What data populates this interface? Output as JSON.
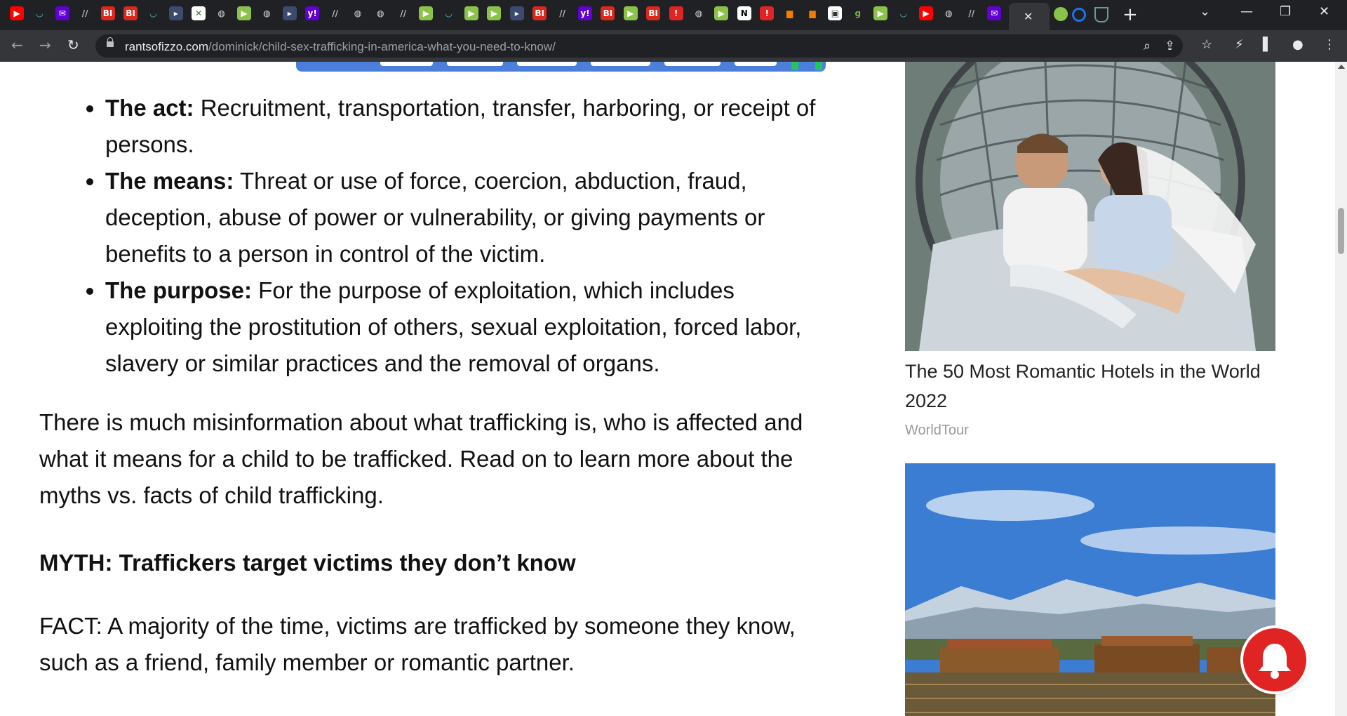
{
  "browser": {
    "tabs_icons": [
      "youtube-icon",
      "shield-icon",
      "yahoo-mail-icon",
      "site-icon",
      "bi-icon",
      "bi-icon",
      "shield-icon",
      "arrow-icon",
      "sheet-icon",
      "globe-icon",
      "play-icon",
      "globe-icon",
      "arrow-icon",
      "yahoo-icon",
      "site-icon",
      "globe-icon",
      "globe-icon",
      "site-icon",
      "play-icon",
      "shield-icon",
      "play-icon",
      "play-icon",
      "arrow-icon",
      "bi-icon",
      "site-icon",
      "yahoo-icon",
      "bi-icon",
      "play-icon",
      "bi-icon",
      "pin-icon",
      "globe-icon",
      "play-icon",
      "news-icon",
      "pin-icon",
      "bookmark-icon",
      "bookmark-icon",
      "lock-icon",
      "g-icon",
      "play-icon",
      "shield-icon",
      "youtube-icon",
      "globe-icon",
      "site-icon",
      "yahoo-mail-icon"
    ],
    "active_tab_close": "✕",
    "new_tab": "+",
    "url_host": "rantsofizzo.com",
    "url_path": "/dominick/child-sex-trafficking-in-america-what-you-need-to-know/"
  },
  "article": {
    "bullets": [
      {
        "term": "The act:",
        "text": " Recruitment, transportation, transfer, harboring, or receipt of persons."
      },
      {
        "term": "The means:",
        "text": " Threat or use of force, coercion, abduction, fraud, deception, abuse of power or vulnerability, or giving payments or benefits to a person in control of the victim."
      },
      {
        "term": "The purpose:",
        "text": " For the purpose of exploitation, which includes exploiting the prostitution of others, sexual exploitation, forced labor, slavery or similar practices and the removal of organs."
      }
    ],
    "paragraph": "There is much misinformation about what trafficking is, who is affected and what it means for a child to be trafficked. Read on to learn more about the myths vs. facts of child trafficking.",
    "myth_heading": "MYTH: Traffickers target victims they don’t know",
    "fact": "FACT: A majority of the time, victims are trafficked by someone they know, such as a friend, family member or romantic partner."
  },
  "sidebar": {
    "ad1_title": "The 50 Most Romantic Hotels in the World 2022",
    "ad1_source": "WorldTour"
  },
  "colors": {
    "chrome_dark": "#202124",
    "chrome_toolbar": "#35363a",
    "notification_red": "#e02424"
  }
}
